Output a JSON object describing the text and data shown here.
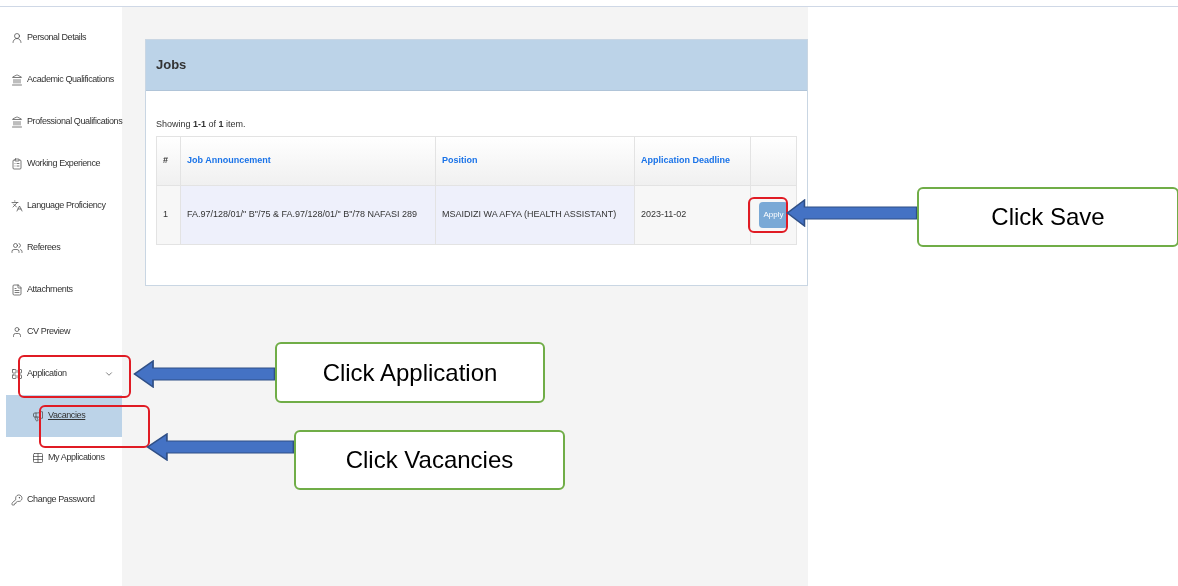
{
  "sidebar": {
    "items": [
      {
        "label": "Personal Details",
        "selected": false
      },
      {
        "label": "Academic Qualifications",
        "selected": false
      },
      {
        "label": "Professional Qualifications",
        "selected": false
      },
      {
        "label": "Working Experience",
        "selected": false
      },
      {
        "label": "Language Proficiency",
        "selected": false
      },
      {
        "label": "Referees",
        "selected": false
      },
      {
        "label": "Attachments",
        "selected": false
      },
      {
        "label": "CV Preview",
        "selected": false
      },
      {
        "label": "Application",
        "selected": false,
        "expanded": true,
        "children": [
          {
            "label": "Vacancies",
            "selected": true
          },
          {
            "label": "My Applications",
            "selected": false
          }
        ]
      },
      {
        "label": "Change Password",
        "selected": false
      }
    ]
  },
  "panel": {
    "title": "Jobs",
    "summary": "Showing **1-1** of **1** item.",
    "table": {
      "columns": [
        "#",
        "Job Announcement",
        "Position",
        "Application Deadline"
      ],
      "rows": [
        {
          "cells": [
            "1",
            "FA.97/128/01/\" B\"/75 & FA.97/128/01/\" B\"/78 NAFASI 289",
            "MSAIDIZI WA AFYA (HEALTH ASSISTANT)",
            "2023-11-02"
          ],
          "action": "Apply"
        }
      ]
    }
  },
  "callouts": [
    {
      "text": "Click Save"
    },
    {
      "text": "Click Application"
    },
    {
      "text": "Click Vacancies"
    }
  ]
}
